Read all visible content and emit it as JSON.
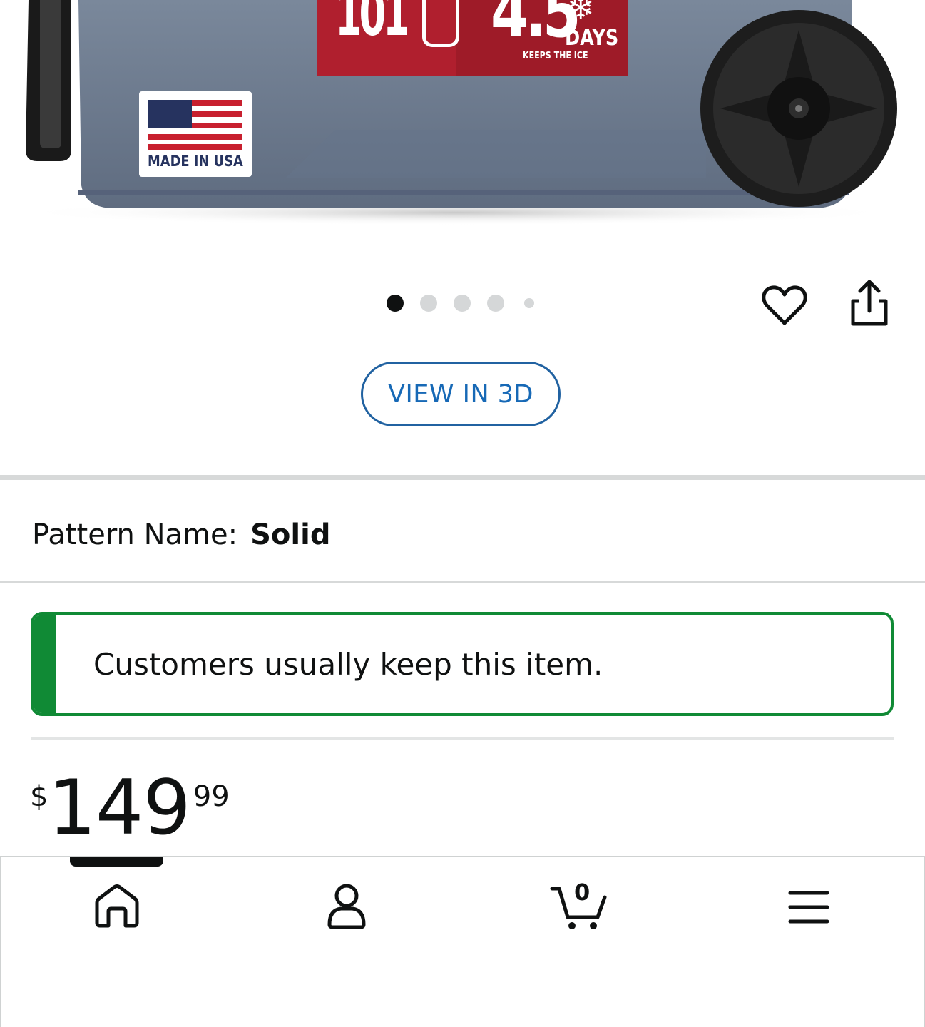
{
  "product_image": {
    "badge_big": "4.5",
    "badge_side": "101",
    "badge_days": "DAYS",
    "badge_caption": "KEEPS THE ICE",
    "flag_label": "MADE IN USA",
    "colors": {
      "body": "#6e7d92",
      "badge": "#b01f2e",
      "wheel": "#1e1e1e"
    }
  },
  "carousel": {
    "count": 5,
    "active_index": 0
  },
  "actions": {
    "wishlist_icon": "heart-outline-icon",
    "share_icon": "share-icon"
  },
  "view_3d": {
    "label": "VIEW IN 3D"
  },
  "pattern": {
    "label": "Pattern Name:",
    "value": "Solid"
  },
  "return_notice": {
    "text": "Customers usually keep this item."
  },
  "price": {
    "symbol": "$",
    "whole": "149",
    "fraction": "99"
  },
  "bottom_nav": {
    "items": [
      "home-icon",
      "account-icon",
      "cart-icon",
      "menu-icon"
    ],
    "active": "home-icon",
    "cart_count": "0"
  },
  "colors": {
    "accent_green": "#108a35",
    "link_blue": "#1769b6",
    "text": "#0f1111"
  }
}
